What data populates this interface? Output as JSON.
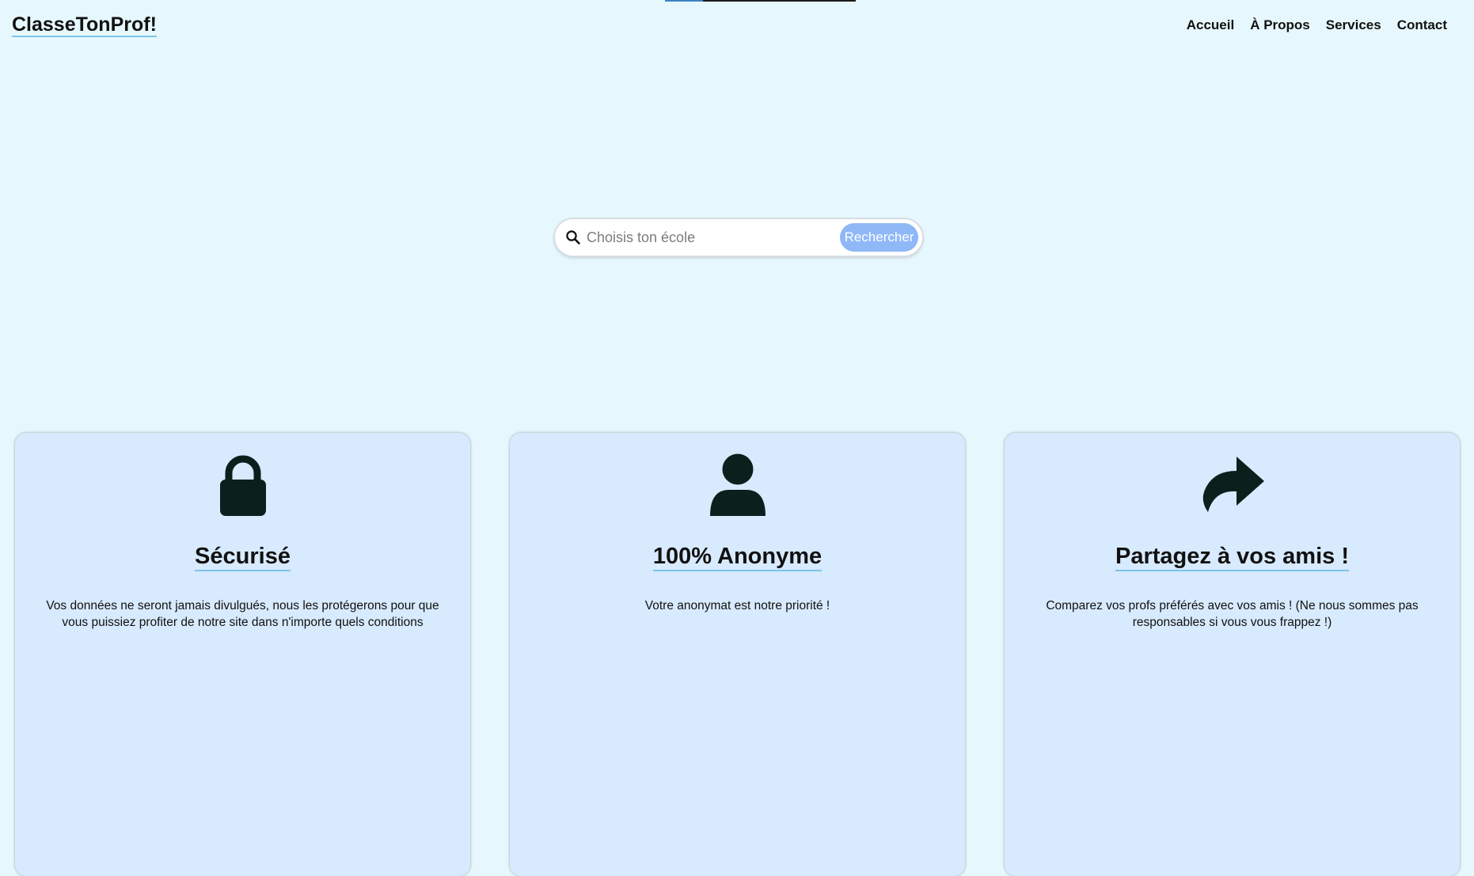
{
  "header": {
    "logo": "ClasseTonProf!",
    "nav": [
      {
        "label": "Accueil"
      },
      {
        "label": "À Propos"
      },
      {
        "label": "Services"
      },
      {
        "label": "Contact"
      }
    ]
  },
  "search": {
    "placeholder": "Choisis ton école",
    "value": "",
    "button_label": "Rechercher"
  },
  "features": [
    {
      "icon": "lock-icon",
      "title": "Sécurisé",
      "text": "Vos données ne seront jamais divulgués, nous les protégerons pour que vous puissiez profiter de notre site dans n'importe quels conditions"
    },
    {
      "icon": "user-icon",
      "title": "100% Anonyme",
      "text": "Votre anonymat est notre priorité !"
    },
    {
      "icon": "share-icon",
      "title": "Partagez à vos amis !",
      "text": "Comparez vos profs préférés avec vos amis ! (Ne nous sommes pas responsables si vous vous frappez !)"
    }
  ],
  "colors": {
    "background": "#e6f8fd",
    "card": "#d8eafd",
    "accent_underline": "#7cc4ea",
    "search_button": "#8fb8f7",
    "icon": "#0b201d"
  }
}
